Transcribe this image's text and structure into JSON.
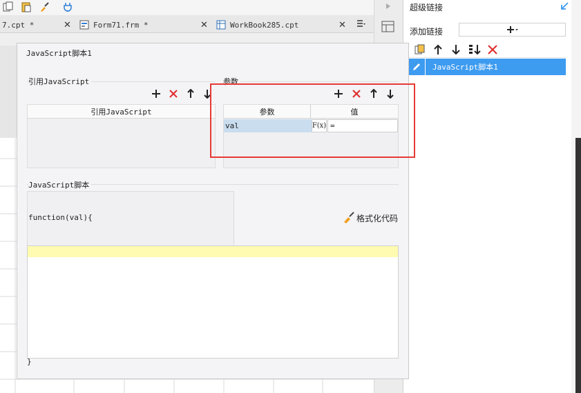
{
  "tabs": [
    {
      "label": "7.cpt *"
    },
    {
      "label": "Form71.frm *"
    },
    {
      "label": "WorkBook285.cpt"
    }
  ],
  "dialog": {
    "title": "JavaScript脚本1",
    "ref_section": {
      "label": "引用JavaScript",
      "column_header": "引用JavaScript"
    },
    "params_section": {
      "label": "参数",
      "columns": [
        "参数",
        "值"
      ],
      "rows": [
        {
          "name": "val",
          "formula_label": "F(x)",
          "value": "="
        }
      ]
    },
    "script_section": {
      "label": "JavaScript脚本",
      "signature": "function(val){",
      "format_button": "格式化代码",
      "closing_brace": "}"
    }
  },
  "right_panel": {
    "title": "超级链接",
    "add_link_label": "添加链接",
    "links": [
      {
        "label": "JavaScript脚本1",
        "selected": true
      }
    ]
  },
  "colors": {
    "accent": "#3d9bf0",
    "delete_red": "#e03030",
    "highlight_border": "#e53935",
    "param_cell": "#c9ddef",
    "code_line": "#fffbb0"
  }
}
